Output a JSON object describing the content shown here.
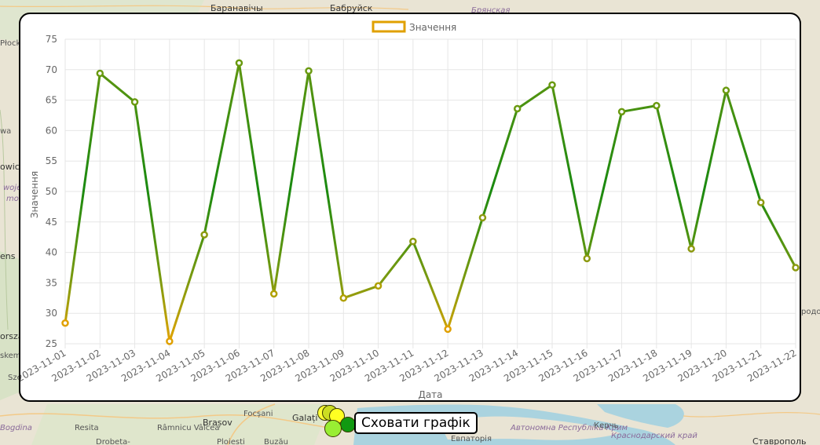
{
  "map": {
    "labels": [
      {
        "text": "Баранавічы",
        "cls": "city"
      },
      {
        "text": "Бабруйск",
        "cls": "city"
      },
      {
        "text": "Брянская",
        "cls": "it"
      },
      {
        "text": "Płock",
        "cls": ""
      },
      {
        "text": "wa",
        "cls": ""
      },
      {
        "text": "owic",
        "cls": "city"
      },
      {
        "text": "woje",
        "cls": "it"
      },
      {
        "text": "mo",
        "cls": "it"
      },
      {
        "text": "ens",
        "cls": "city"
      },
      {
        "text": "ország",
        "cls": "city"
      },
      {
        "text": "skem",
        "cls": ""
      },
      {
        "text": "Sze",
        "cls": ""
      },
      {
        "text": "Bogdina",
        "cls": "it"
      },
      {
        "text": "Resita",
        "cls": ""
      },
      {
        "text": "Râmnicu Vâlcea",
        "cls": ""
      },
      {
        "text": "Brașov",
        "cls": "city"
      },
      {
        "text": "Focșani",
        "cls": ""
      },
      {
        "text": "Drobeta-",
        "cls": ""
      },
      {
        "text": "Ploiesti",
        "cls": ""
      },
      {
        "text": "Buzău",
        "cls": ""
      },
      {
        "text": "Galați",
        "cls": "city"
      },
      {
        "text": "Автономна Республіка Крим",
        "cls": "it"
      },
      {
        "text": "Керчь",
        "cls": ""
      },
      {
        "text": "Краснодарский край",
        "cls": "it"
      },
      {
        "text": "Евпаторія",
        "cls": ""
      },
      {
        "text": "Ставрополь",
        "cls": "city"
      },
      {
        "text": "родо",
        "cls": ""
      }
    ]
  },
  "chart_data": {
    "type": "line",
    "legend": {
      "label": "Значення",
      "position": "top"
    },
    "xlabel": "Дата",
    "ylabel": "Значення",
    "ylim": [
      25,
      75
    ],
    "yticks": [
      25,
      30,
      35,
      40,
      45,
      50,
      55,
      60,
      65,
      70,
      75
    ],
    "grid": true,
    "x": [
      "2023-11-01",
      "2023-11-02",
      "2023-11-03",
      "2023-11-04",
      "2023-11-05",
      "2023-11-06",
      "2023-11-07",
      "2023-11-08",
      "2023-11-09",
      "2023-11-10",
      "2023-11-11",
      "2023-11-12",
      "2023-11-13",
      "2023-11-14",
      "2023-11-15",
      "2023-11-16",
      "2023-11-17",
      "2023-11-18",
      "2023-11-19",
      "2023-11-20",
      "2023-11-21",
      "2023-11-22"
    ],
    "series": [
      {
        "name": "Значення",
        "values": [
          28.4,
          69.4,
          64.7,
          25.4,
          42.9,
          71.1,
          33.2,
          69.8,
          32.5,
          34.5,
          41.8,
          27.4,
          45.7,
          63.6,
          67.5,
          39.0,
          63.1,
          64.1,
          40.6,
          66.6,
          48.2,
          37.5
        ]
      }
    ]
  },
  "controls": {
    "hide_chart_label": "Сховати графік"
  }
}
